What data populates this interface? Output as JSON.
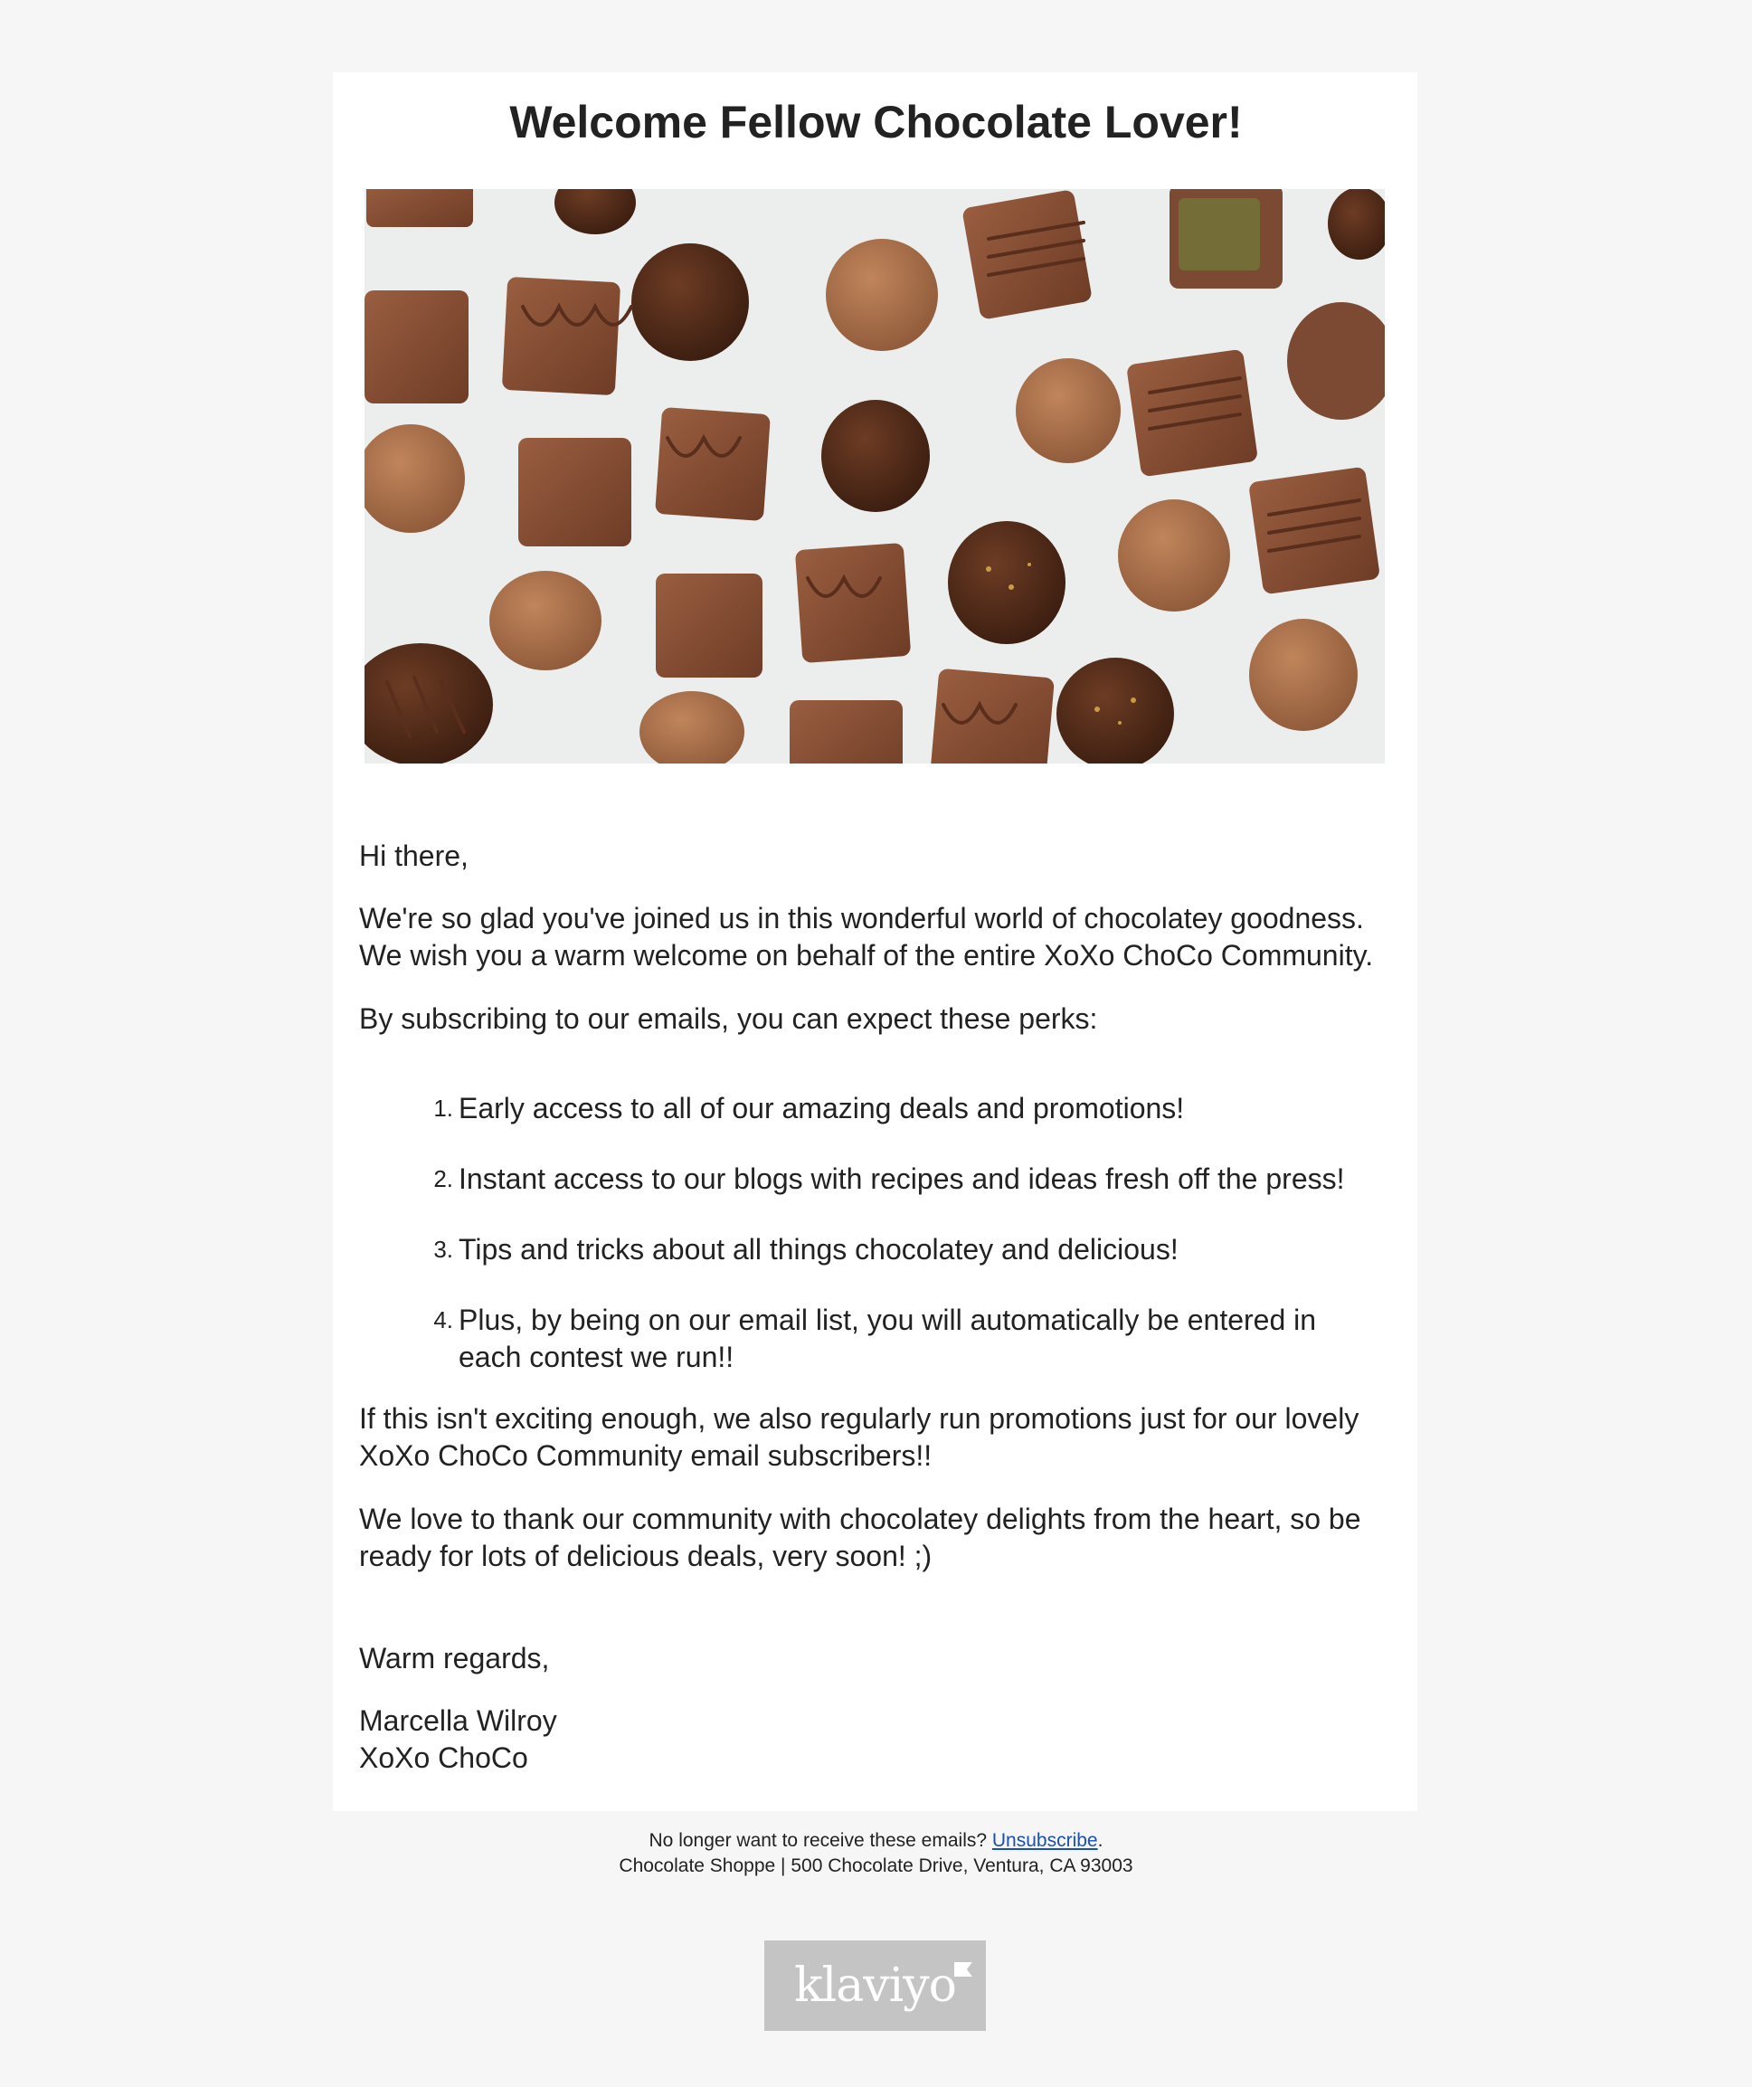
{
  "email": {
    "title": "Welcome Fellow Chocolate Lover!",
    "hero_image": "chocolate-truffles-assortment",
    "greeting": "Hi there,",
    "intro": "We're so glad you've joined us in this wonderful world of chocolatey goodness. We wish you a warm welcome on behalf of the entire XoXo ChoCo Community.",
    "perks_intro": "By subscribing to our emails, you can expect these perks:",
    "perks": [
      {
        "num": "1.",
        "line1": "Early access to all of our amazing deals and promotions!",
        "line2": ""
      },
      {
        "num": "2.",
        "line1": "Instant access to our blogs with recipes and ideas fresh off the press!",
        "line2": ""
      },
      {
        "num": "3.",
        "line1": "Tips and tricks about all things chocolatey and delicious!",
        "line2": ""
      },
      {
        "num": "4.",
        "line1": "Plus, by being on our email list, you will automatically be entered in",
        "line2": "each contest we run!!"
      }
    ],
    "promo_line1": "If this isn't exciting enough, we also regularly run promotions just for our lovely",
    "promo_line2": "XoXo ChoCo Community email subscribers!!",
    "thanks_line1": "We love to thank our community with chocolatey delights from the heart, so be",
    "thanks_line2": "ready for lots of delicious deals, very soon! ;)",
    "sign_off": "Warm regards,",
    "signature_name": "Marcella Wilroy",
    "signature_company": "XoXo ChoCo"
  },
  "footer": {
    "unsubscribe_prefix": "No longer want to receive these emails? ",
    "unsubscribe_link": "Unsubscribe",
    "unsubscribe_suffix": ".",
    "address": "Chocolate Shoppe | 500 Chocolate Drive, Ventura, CA 93003"
  },
  "badge": {
    "logo_text": "klaviyo"
  },
  "colors": {
    "page_bg": "#f6f6f6",
    "card_bg": "#ffffff",
    "text": "#222222",
    "link": "#1a4fb5",
    "badge_bg": "#c4c4c4"
  }
}
